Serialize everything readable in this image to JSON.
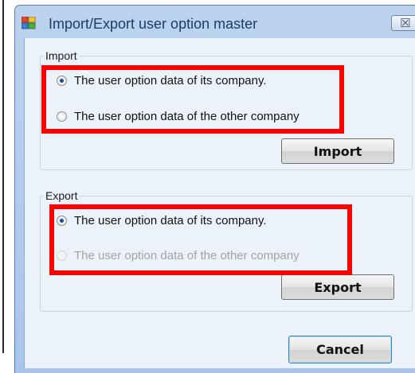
{
  "window": {
    "title": "Import/Export user option master",
    "close_glyph": "☒"
  },
  "import_group": {
    "legend": "Import",
    "options": [
      {
        "label": "The user option data of its company.",
        "checked": true,
        "enabled": true
      },
      {
        "label": "The user option data of the other company",
        "checked": false,
        "enabled": true
      }
    ],
    "button_label": "Import"
  },
  "export_group": {
    "legend": "Export",
    "options": [
      {
        "label": "The user option data of its company.",
        "checked": true,
        "enabled": true
      },
      {
        "label": "The user option data of the other company",
        "checked": false,
        "enabled": false
      }
    ],
    "button_label": "Export"
  },
  "cancel_label": "Cancel",
  "colors": {
    "highlight": "#ff0000",
    "title_text": "#1e3b66",
    "client_bg": "#ecf2f9",
    "radio_dot": "#1a4a99"
  },
  "icons": {
    "app": "app-window-icon",
    "close": "close-icon"
  }
}
